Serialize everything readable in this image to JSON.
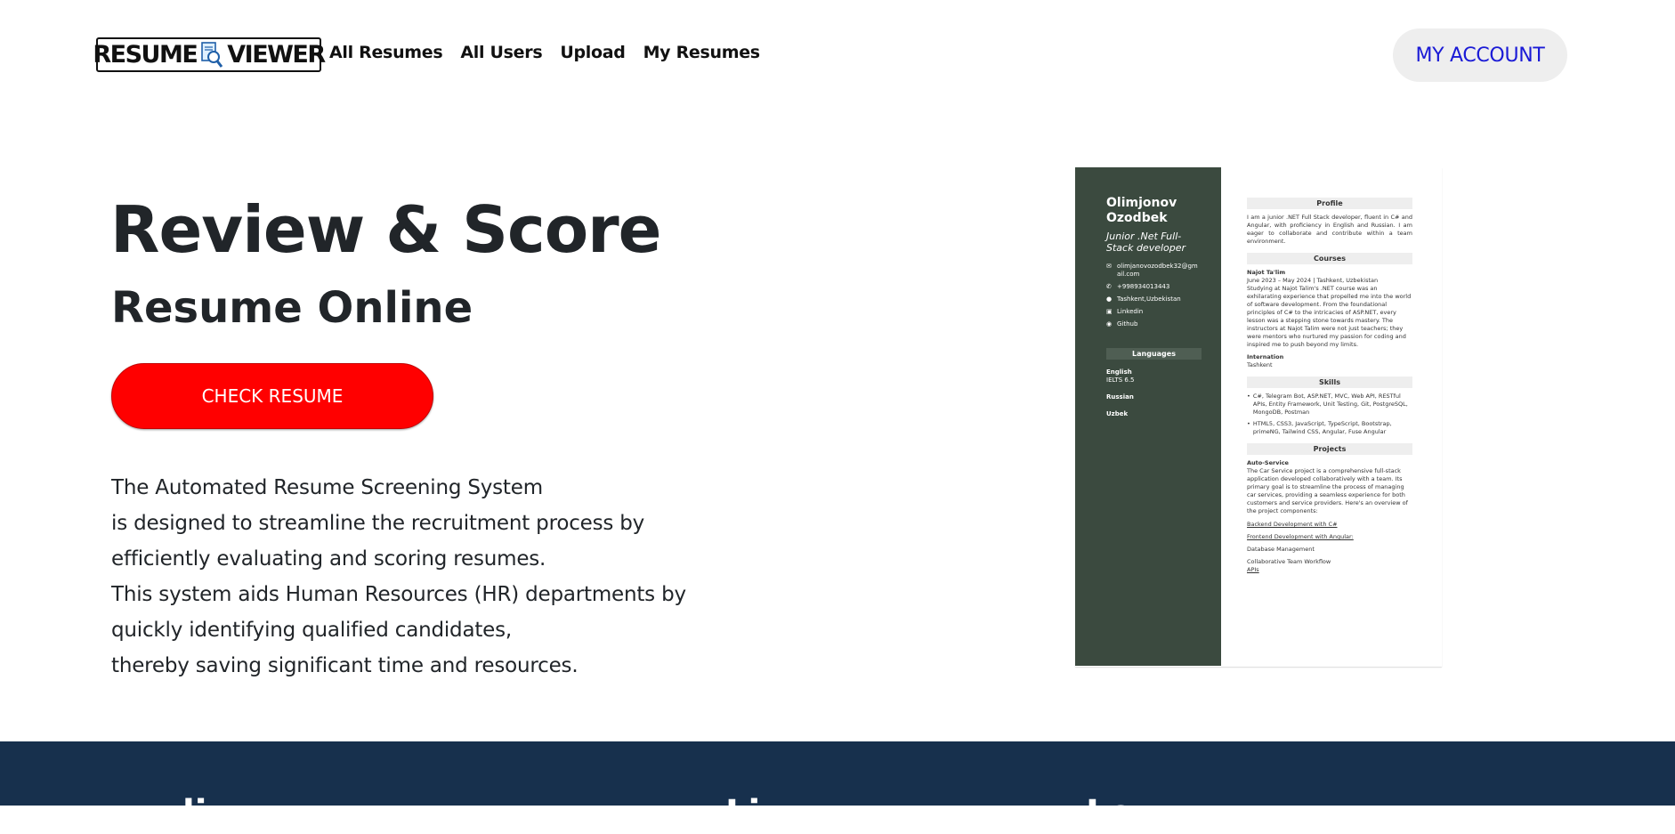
{
  "header": {
    "logo_left": "RESUME",
    "logo_right": "VIEWER",
    "logo_icon": "magnifier-document-icon",
    "nav": [
      "All Resumes",
      "All Users",
      "Upload",
      "My Resumes"
    ],
    "account_label": "MY ACCOUNT"
  },
  "hero": {
    "title": "Review & Score",
    "subtitle": "Resume Online",
    "cta_label": "CHECK RESUME",
    "description": [
      "The Automated Resume Screening System",
      "is designed to streamline the recruitment process by",
      "efficiently evaluating and scoring resumes.",
      "This system aids Human Resources (HR) departments by",
      "quickly identifying qualified candidates,",
      "thereby saving significant time and resources."
    ]
  },
  "resume": {
    "name": "Olimjonov Ozodbek",
    "role": "Junior .Net Full-Stack developer",
    "contacts": [
      {
        "icon": "mail-icon",
        "text": "olimjanovozodbek32@gmail.com"
      },
      {
        "icon": "phone-icon",
        "text": "+998934013443"
      },
      {
        "icon": "location-icon",
        "text": "Tashkent,Uzbekistan"
      },
      {
        "icon": "linkedin-icon",
        "text": "Linkedin"
      },
      {
        "icon": "github-icon",
        "text": "Github"
      }
    ],
    "languages_heading": "Languages",
    "languages": [
      {
        "name": "English",
        "level": "IELTS 6.5"
      },
      {
        "name": "Russian",
        "level": ""
      },
      {
        "name": "Uzbek",
        "level": ""
      }
    ],
    "profile_heading": "Profile",
    "profile_text": "I am a junior .NET Full Stack developer, fluent in C# and Angular, with proficiency in English and Russian. I am eager to collaborate and contribute within a team environment.",
    "courses_heading": "Courses",
    "course_name": "Najot Ta'lim",
    "course_meta": "June 2023 – May 2024 | Tashkent, Uzbekistan",
    "course_text": "Studying at Najot Talim's .NET course was an exhilarating experience that propelled me into the world of software development. From the foundational principles of C# to the intricacies of ASP.NET, every lesson was a stepping stone towards mastery. The instructors at Najot Talim were not just teachers; they were mentors who nurtured my passion for coding and inspired me to push beyond my limits.",
    "internation_label": "Internation",
    "internation_place": "Tashkent",
    "skills_heading": "Skills",
    "skills": [
      "C#, Telegram Bot, ASP.NET, MVC, Web API, RESTful APIs, Entity Framework, Unit Testing, Git, PostgreSQL, MongoDB, Postman",
      "HTML5, CSS3, JavaScript, TypeScript, Bootstrap, primeNG, Tailwind CSS, Angular, Fuse Angular"
    ],
    "projects_heading": "Projects",
    "project_name": "Auto-Service",
    "project_text": "The Car Service project is a comprehensive full-stack application developed collaboratively with a team. Its primary goal is to streamline the process of managing car services, providing a seamless experience for both customers and service providers. Here's an overview of the project components:",
    "project_components": [
      "Backend Development with C#",
      "Frontend Development with Angular:",
      "Database Management",
      "Collaborative Team Workflow",
      "APIs"
    ]
  },
  "footer": {
    "headings": [
      "li",
      "Li",
      "Lo"
    ]
  }
}
